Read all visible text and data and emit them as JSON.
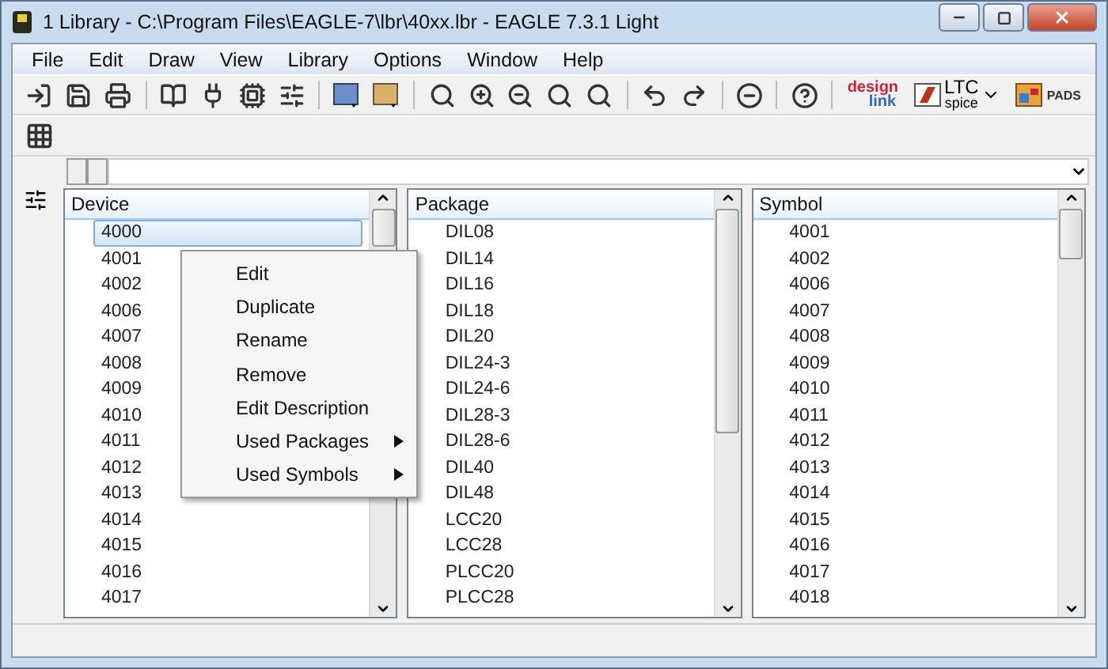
{
  "window": {
    "title": "1 Library - C:\\Program Files\\EAGLE-7\\lbr\\40xx.lbr - EAGLE 7.3.1 Light"
  },
  "menu": [
    {
      "label": "File"
    },
    {
      "label": "Edit"
    },
    {
      "label": "Draw"
    },
    {
      "label": "View"
    },
    {
      "label": "Library"
    },
    {
      "label": "Options"
    },
    {
      "label": "Window"
    },
    {
      "label": "Help"
    }
  ],
  "toolbar_logos": [
    {
      "kind": "designlink",
      "top": "design",
      "bottom": "link"
    },
    {
      "kind": "ltspice",
      "top": "LTC",
      "bottom": "spice"
    },
    {
      "kind": "pads",
      "top": "PADS"
    }
  ],
  "panels": [
    {
      "heading": "Device",
      "items": [
        {
          "label": "4000",
          "selected": true
        },
        {
          "label": "4001",
          "selected": false
        },
        {
          "label": "4002",
          "selected": false
        },
        {
          "label": "4006",
          "selected": false
        },
        {
          "label": "4007",
          "selected": false
        },
        {
          "label": "4008",
          "selected": false
        },
        {
          "label": "4009",
          "selected": false
        },
        {
          "label": "4010",
          "selected": false
        },
        {
          "label": "4011",
          "selected": false
        },
        {
          "label": "4012",
          "selected": false
        },
        {
          "label": "4013",
          "selected": false
        },
        {
          "label": "4014",
          "selected": false
        },
        {
          "label": "4015",
          "selected": false
        },
        {
          "label": "4016",
          "selected": false
        },
        {
          "label": "4017",
          "selected": false
        }
      ]
    },
    {
      "heading": "Package",
      "items": [
        {
          "label": "DIL08",
          "selected": false
        },
        {
          "label": "DIL14",
          "selected": false
        },
        {
          "label": "DIL16",
          "selected": false
        },
        {
          "label": "DIL18",
          "selected": false
        },
        {
          "label": "DIL20",
          "selected": false
        },
        {
          "label": "DIL24-3",
          "selected": false
        },
        {
          "label": "DIL24-6",
          "selected": false
        },
        {
          "label": "DIL28-3",
          "selected": false
        },
        {
          "label": "DIL28-6",
          "selected": false
        },
        {
          "label": "DIL40",
          "selected": false
        },
        {
          "label": "DIL48",
          "selected": false
        },
        {
          "label": "LCC20",
          "selected": false
        },
        {
          "label": "LCC28",
          "selected": false
        },
        {
          "label": "PLCC20",
          "selected": false
        },
        {
          "label": "PLCC28",
          "selected": false
        }
      ]
    },
    {
      "heading": "Symbol",
      "items": [
        {
          "label": "4001",
          "selected": false
        },
        {
          "label": "4002",
          "selected": false
        },
        {
          "label": "4006",
          "selected": false
        },
        {
          "label": "4007",
          "selected": false
        },
        {
          "label": "4008",
          "selected": false
        },
        {
          "label": "4009",
          "selected": false
        },
        {
          "label": "4010",
          "selected": false
        },
        {
          "label": "4011",
          "selected": false
        },
        {
          "label": "4012",
          "selected": false
        },
        {
          "label": "4013",
          "selected": false
        },
        {
          "label": "4014",
          "selected": false
        },
        {
          "label": "4015",
          "selected": false
        },
        {
          "label": "4016",
          "selected": false
        },
        {
          "label": "4017",
          "selected": false
        },
        {
          "label": "4018",
          "selected": false
        }
      ]
    }
  ],
  "context_menu": [
    {
      "label": "Edit",
      "submenu": false
    },
    {
      "label": "Duplicate",
      "submenu": false
    },
    {
      "label": "Rename",
      "submenu": false
    },
    {
      "label": "Remove",
      "submenu": false
    },
    {
      "label": "Edit Description",
      "submenu": false
    },
    {
      "label": "Used Packages",
      "submenu": true
    },
    {
      "label": "Used Symbols",
      "submenu": true
    }
  ]
}
